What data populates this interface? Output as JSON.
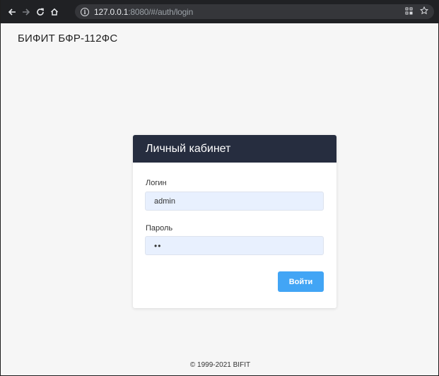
{
  "browser": {
    "url_host": "127.0.0.1",
    "url_rest": ":8080/#/auth/login"
  },
  "page": {
    "brand": "БИФИТ БФР-112ФС",
    "footer": "© 1999-2021 BIFIT"
  },
  "login": {
    "title": "Личный кабинет",
    "username_label": "Логин",
    "username_value": "admin",
    "password_label": "Пароль",
    "password_value": "••",
    "submit_label": "Войти"
  },
  "colors": {
    "header_bg": "#262d3f",
    "button_bg": "#42a5f5",
    "input_bg": "#e8f0fe"
  }
}
